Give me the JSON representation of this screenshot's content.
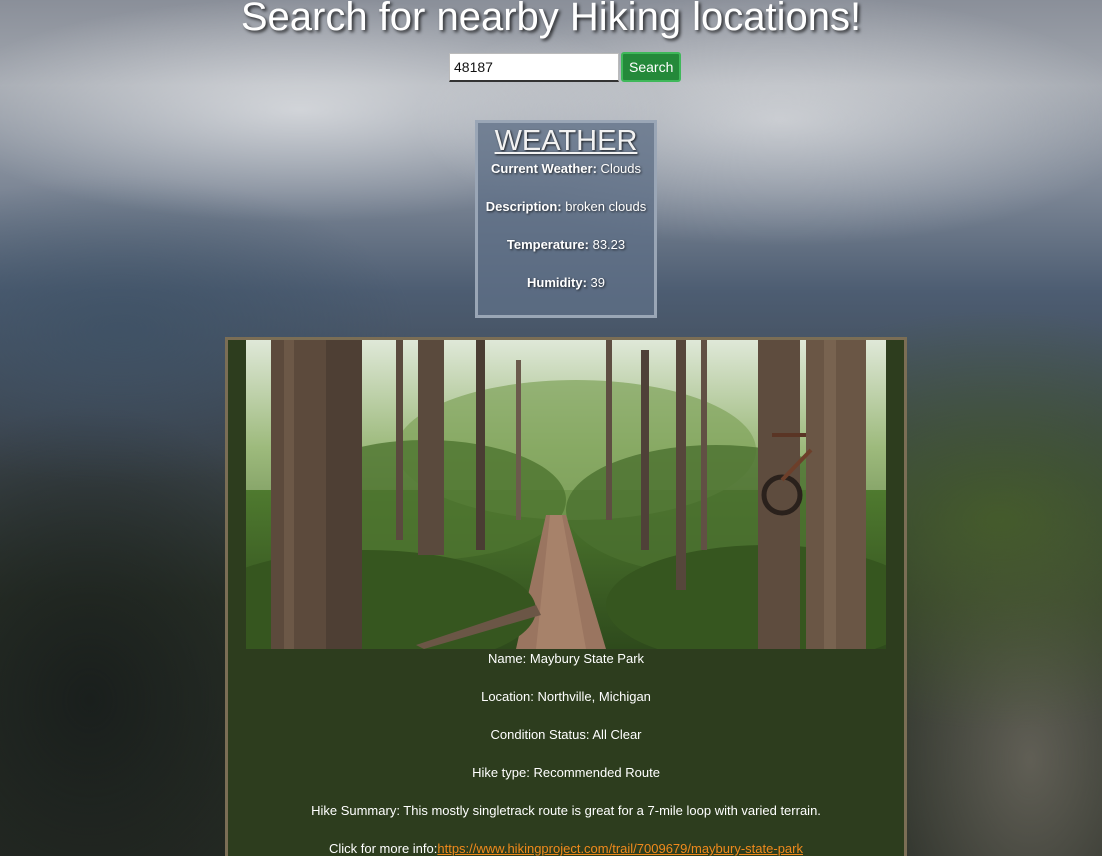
{
  "header": {
    "title": "Search for nearby Hiking locations!"
  },
  "search": {
    "value": "48187",
    "button_label": "Search"
  },
  "weather": {
    "title": "WEATHER",
    "current_label": "Current Weather:",
    "current_value": " Clouds",
    "description_label": "Description:",
    "description_value": " broken clouds",
    "temperature_label": "Temperature:",
    "temperature_value": " 83.23",
    "humidity_label": "Humidity:",
    "humidity_value": " 39"
  },
  "hike": {
    "name": "Name: Maybury State Park",
    "location": "Location: Northville, Michigan",
    "condition": "Condition Status: All Clear",
    "type": "Hike type: Recommended Route",
    "summary": "Hike Summary: This mostly singletrack route is great for a 7-mile loop with varied terrain.",
    "more_info_label": "Click for more info:",
    "more_info_url": "https://www.hikingproject.com/trail/7009679/maybury-state-park"
  },
  "colors": {
    "search_button": "#24893a",
    "card_background": "#2d3d1e",
    "link": "#f08a1c"
  }
}
